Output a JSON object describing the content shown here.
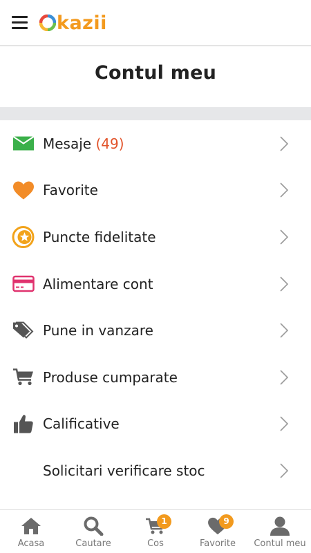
{
  "header": {
    "logo_text": "kazii",
    "logo_colors": [
      "#e8483b",
      "#3b8fd6",
      "#6bbf4e",
      "#f7b731"
    ],
    "icons": {
      "menu": "hamburger-icon"
    }
  },
  "page": {
    "title": "Contul meu"
  },
  "menu": {
    "items": [
      {
        "label": "Mesaje",
        "count": "(49)",
        "icon": "envelope-icon",
        "color": "#3bb04a"
      },
      {
        "label": "Favorite",
        "icon": "heart-icon",
        "color": "#f28c28"
      },
      {
        "label": "Puncte fidelitate",
        "icon": "star-coin-icon",
        "color": "#f2a31b"
      },
      {
        "label": "Alimentare cont",
        "icon": "credit-card-icon",
        "color": "#e0326e"
      },
      {
        "label": "Pune in vanzare",
        "icon": "tags-icon",
        "color": "#555555"
      },
      {
        "label": "Produse cumparate",
        "icon": "cart-icon",
        "color": "#555555"
      },
      {
        "label": "Calificative",
        "icon": "thumbs-up-icon",
        "color": "#555555"
      },
      {
        "label": "Solicitari verificare stoc",
        "icon": "none"
      }
    ]
  },
  "bottom_nav": {
    "items": [
      {
        "label": "Acasa",
        "icon": "home-icon"
      },
      {
        "label": "Cautare",
        "icon": "search-icon"
      },
      {
        "label": "Cos",
        "icon": "cart-icon",
        "badge": "1"
      },
      {
        "label": "Favorite",
        "icon": "heart-icon",
        "badge": "9"
      },
      {
        "label": "Contul meu",
        "icon": "user-icon"
      }
    ],
    "icon_color": "#6b6b6b",
    "badge_color": "#f29a1e"
  }
}
